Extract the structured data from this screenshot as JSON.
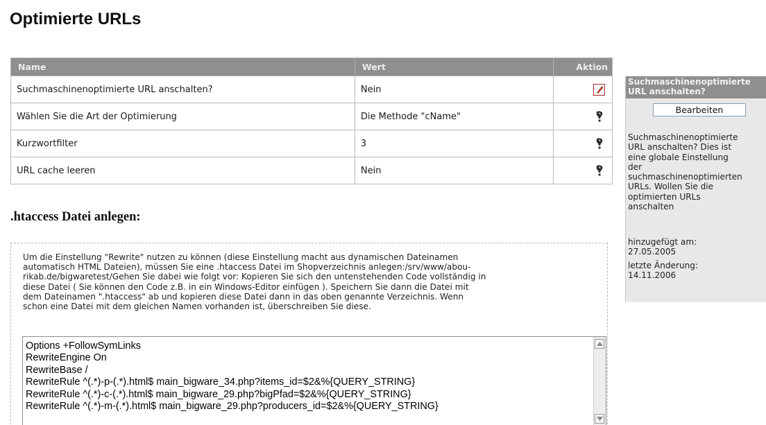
{
  "page": {
    "title": "Optimierte URLs"
  },
  "table": {
    "headers": {
      "name": "Name",
      "value": "Wert",
      "action": "Aktion"
    },
    "rows": [
      {
        "name": "Suchmaschinenoptimierte URL anschalten?",
        "value": "Nein",
        "action_icon": "edit-active-icon"
      },
      {
        "name": "Wählen Sie die Art der Optimierung",
        "value": "Die Methode \"cName\"",
        "action_icon": "info-icon"
      },
      {
        "name": "Kurzwortfilter",
        "value": "3",
        "action_icon": "info-icon"
      },
      {
        "name": "URL cache leeren",
        "value": "Nein",
        "action_icon": "info-icon"
      }
    ]
  },
  "htaccess": {
    "title": ".htaccess Datei anlegen:",
    "description_lines": [
      "Um die Einstellung \"Rewrite\" nutzen zu können (diese Einstellung macht aus dynamischen Dateinamen",
      "automatisch HTML Dateien), müssen Sie eine .htaccess Datei im Shopverzeichnis anlegen:/srv/www/abou-",
      "rikab.de/bigwaretest/Gehen Sie dabei wie folgt vor: Kopieren Sie sich den untenstehenden Code vollständig in",
      "diese Datei ( Sie können den Code z.B. in ein Windows-Editor einfügen ). Speichern Sie dann die Datei mit",
      "dem Dateinamen \".htaccess\" ab und kopieren diese Datei dann in das oben genannte Verzeichnis. Wenn",
      "schon eine Datei mit dem gleichen Namen vorhanden ist, überschreiben Sie diese."
    ],
    "code_lines": [
      "Options +FollowSymLinks",
      "RewriteEngine On",
      "RewriteBase /",
      "RewriteRule ^(.*)-p-(.*).html$ main_bigware_34.php?items_id=$2&%{QUERY_STRING}",
      "RewriteRule ^(.*)-c-(.*).html$ main_bigware_29.php?bigPfad=$2&%{QUERY_STRING}",
      "RewriteRule ^(.*)-m-(.*).html$ main_bigware_29.php?producers_id=$2&%{QUERY_STRING}"
    ]
  },
  "infobox": {
    "title_lines": [
      "Suchmaschinenoptimierte",
      "URL anschalten?"
    ],
    "edit_label": "Bearbeiten",
    "description_lines": [
      "Suchmaschinenoptimierte",
      "URL anschalten? Dies ist",
      "eine globale Einstellung",
      "der",
      "suchmaschinenoptimierten",
      "URLs. Wollen Sie die",
      "optimierten URLs",
      "anschalten"
    ],
    "added_label": "hinzugefügt am:",
    "added_date": "27.05.2005",
    "changed_label": "letzte Änderung:",
    "changed_date": "14.11.2006"
  }
}
